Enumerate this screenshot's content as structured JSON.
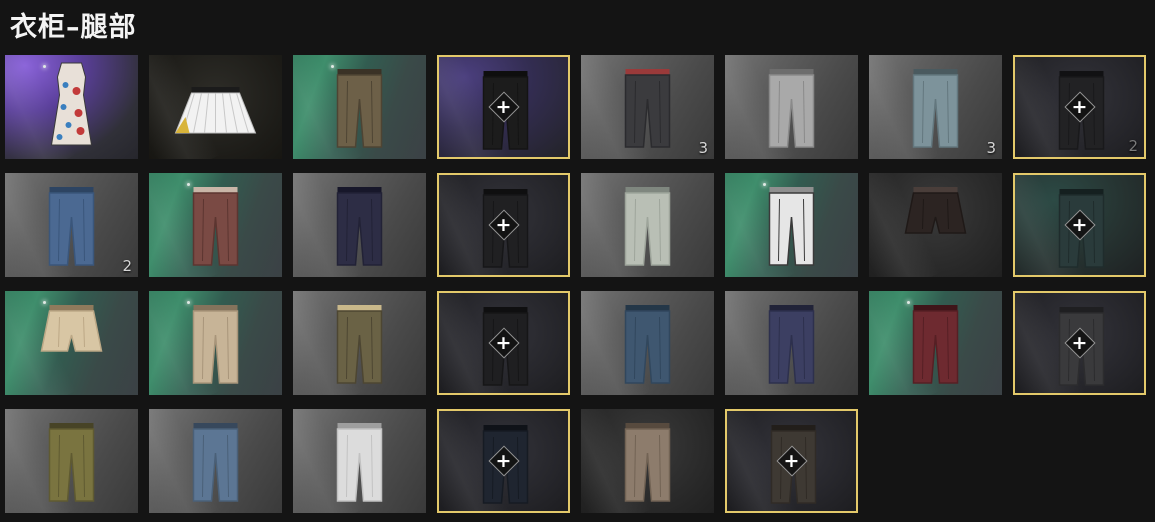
{
  "title": "衣柜–腿部",
  "colors": {
    "selected_border": "#e3c96a",
    "page_background": "#141414"
  },
  "items": [
    {
      "id": "floral-dress",
      "bg": "purple",
      "garment": "dress",
      "colors": [
        "#e8e0d8",
        "#c23a3a",
        "#3a3a3a"
      ],
      "selected": false,
      "slot": false,
      "count": ""
    },
    {
      "id": "pleated-skirt",
      "bg": "dark",
      "garment": "skirt",
      "colors": [
        "#f2f2f2",
        "#d8b43a",
        "#1b1b1b"
      ],
      "selected": false,
      "slot": false,
      "count": ""
    },
    {
      "id": "olive-cargo-pants",
      "bg": "green",
      "garment": "pants",
      "colors": [
        "#6d6048",
        "#4e4433",
        "#3a3226"
      ],
      "selected": false,
      "slot": false,
      "count": ""
    },
    {
      "id": "black-pants-slot",
      "bg": "slot-purple",
      "garment": "pants",
      "colors": [
        "#1c1c1c",
        "#141414",
        "#0e0e0e"
      ],
      "selected": true,
      "slot": true,
      "count": ""
    },
    {
      "id": "dark-jeans",
      "bg": "gray",
      "garment": "pants",
      "colors": [
        "#3b3b3e",
        "#2b2b2e",
        "#9a3a3a"
      ],
      "selected": false,
      "slot": false,
      "count": "3"
    },
    {
      "id": "gray-pants",
      "bg": "gray",
      "garment": "pants",
      "colors": [
        "#a9a9a9",
        "#8a8a8a",
        "#6d6d6d"
      ],
      "selected": false,
      "slot": false,
      "count": ""
    },
    {
      "id": "light-blue-jeans",
      "bg": "gray",
      "garment": "pants",
      "colors": [
        "#7d939b",
        "#63777e",
        "#4a5a5f"
      ],
      "selected": false,
      "slot": false,
      "count": "3"
    },
    {
      "id": "black-pants-slot-2",
      "bg": "slot",
      "garment": "pants",
      "colors": [
        "#222224",
        "#19191b",
        "#111113"
      ],
      "selected": true,
      "slot": true,
      "count": "2"
    },
    {
      "id": "blue-jeans",
      "bg": "gray",
      "garment": "pants",
      "colors": [
        "#4b6992",
        "#3a567b",
        "#2d4462"
      ],
      "selected": false,
      "slot": false,
      "count": "2"
    },
    {
      "id": "plaid-pants",
      "bg": "green",
      "garment": "pants",
      "colors": [
        "#7a4a44",
        "#5c3530",
        "#c9b6a8"
      ],
      "selected": false,
      "slot": false,
      "count": ""
    },
    {
      "id": "navy-slacks",
      "bg": "gray",
      "garment": "pants",
      "colors": [
        "#2d2d45",
        "#222236",
        "#17172a"
      ],
      "selected": false,
      "slot": false,
      "count": ""
    },
    {
      "id": "black-pants-slot-3",
      "bg": "slot",
      "garment": "pants",
      "colors": [
        "#202022",
        "#161618",
        "#0f0f10"
      ],
      "selected": true,
      "slot": true,
      "count": ""
    },
    {
      "id": "washed-jeans",
      "bg": "gray",
      "garment": "pants",
      "colors": [
        "#b9bfb5",
        "#9ea59b",
        "#7f877f"
      ],
      "selected": false,
      "slot": false,
      "count": ""
    },
    {
      "id": "camo-pants",
      "bg": "green",
      "garment": "pants",
      "colors": [
        "#e6e6e6",
        "#3a3a3a",
        "#8f8f8f"
      ],
      "selected": false,
      "slot": false,
      "count": ""
    },
    {
      "id": "leather-shorts",
      "bg": "darkgray",
      "garment": "shorts",
      "colors": [
        "#2c2422",
        "#1f1917",
        "#4a3e3a"
      ],
      "selected": false,
      "slot": false,
      "count": ""
    },
    {
      "id": "teal-pants-slot",
      "bg": "slot-teal",
      "garment": "pants",
      "colors": [
        "#2a3b3b",
        "#1f2c2c",
        "#152020"
      ],
      "selected": true,
      "slot": true,
      "count": ""
    },
    {
      "id": "desert-camo-shorts",
      "bg": "green",
      "garment": "shorts",
      "colors": [
        "#d8c6a4",
        "#bca886",
        "#8f7a5c"
      ],
      "selected": false,
      "slot": false,
      "count": ""
    },
    {
      "id": "desert-cargo-pants",
      "bg": "green",
      "garment": "pants",
      "colors": [
        "#c7b497",
        "#a8957a",
        "#84735c"
      ],
      "selected": false,
      "slot": false,
      "count": ""
    },
    {
      "id": "woodland-camo-pants",
      "bg": "gray",
      "garment": "pants",
      "colors": [
        "#6a6245",
        "#4d4632",
        "#c9b88a"
      ],
      "selected": false,
      "slot": false,
      "count": ""
    },
    {
      "id": "black-pants-slot-4",
      "bg": "slot",
      "garment": "pants",
      "colors": [
        "#1f1f21",
        "#161617",
        "#0f0f10"
      ],
      "selected": true,
      "slot": true,
      "count": ""
    },
    {
      "id": "indigo-jeans",
      "bg": "gray",
      "garment": "pants",
      "colors": [
        "#3f5770",
        "#31475d",
        "#243748"
      ],
      "selected": false,
      "slot": false,
      "count": ""
    },
    {
      "id": "navy-jeans",
      "bg": "gray",
      "garment": "pants",
      "colors": [
        "#3c3f62",
        "#2d304d",
        "#212338"
      ],
      "selected": false,
      "slot": false,
      "count": ""
    },
    {
      "id": "red-pants",
      "bg": "green",
      "garment": "pants",
      "colors": [
        "#6e2a30",
        "#561f24",
        "#3f1519"
      ],
      "selected": false,
      "slot": false,
      "count": ""
    },
    {
      "id": "gray-pants-slot",
      "bg": "slot",
      "garment": "pants",
      "colors": [
        "#3a3a3c",
        "#2c2c2e",
        "#1f1f21"
      ],
      "selected": true,
      "slot": true,
      "count": ""
    },
    {
      "id": "olive-pants",
      "bg": "gray",
      "garment": "pants",
      "colors": [
        "#7a7440",
        "#5f5a31",
        "#474326"
      ],
      "selected": false,
      "slot": false,
      "count": ""
    },
    {
      "id": "stonewash-jeans",
      "bg": "gray",
      "garment": "pants",
      "colors": [
        "#5c7694",
        "#4a6078",
        "#37485c"
      ],
      "selected": false,
      "slot": false,
      "count": ""
    },
    {
      "id": "white-pants",
      "bg": "gray",
      "garment": "pants",
      "colors": [
        "#dcdcdc",
        "#c2c2c2",
        "#9e9e9e"
      ],
      "selected": false,
      "slot": false,
      "count": ""
    },
    {
      "id": "dark-blue-slot",
      "bg": "slot",
      "garment": "pants",
      "colors": [
        "#1f2530",
        "#161b23",
        "#0f1218"
      ],
      "selected": true,
      "slot": true,
      "count": ""
    },
    {
      "id": "khaki-pants",
      "bg": "darkgray",
      "garment": "pants",
      "colors": [
        "#8d7c6c",
        "#726354",
        "#574a3e"
      ],
      "selected": false,
      "slot": false,
      "count": ""
    },
    {
      "id": "khaki-pants-slot",
      "bg": "slot",
      "garment": "pants",
      "colors": [
        "#3e3933",
        "#302b26",
        "#221e1a"
      ],
      "selected": true,
      "slot": true,
      "count": ""
    }
  ]
}
